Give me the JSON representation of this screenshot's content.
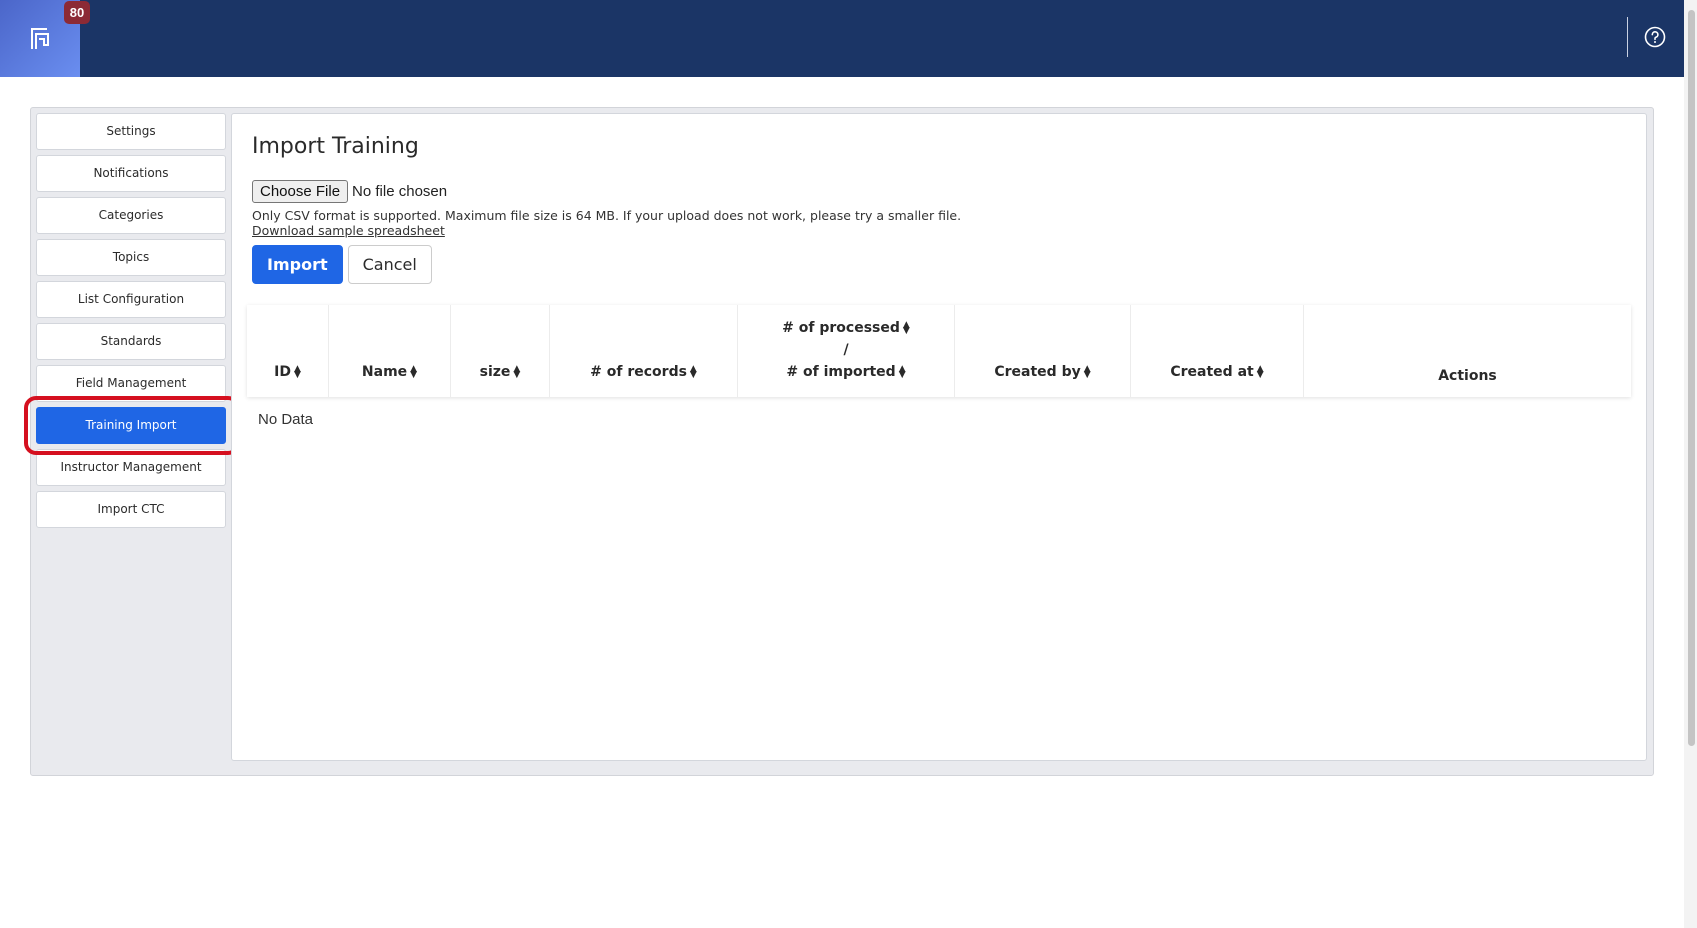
{
  "header": {
    "notification_count": "80",
    "logo_icon": "app-logo-icon",
    "help_icon": "question-circle-icon",
    "colors": {
      "topbar": "#1b3566",
      "accent": "#1f66e5",
      "badge": "#8c2a35",
      "highlight": "#d5101f"
    }
  },
  "sidebar": {
    "items": [
      {
        "label": "Settings"
      },
      {
        "label": "Notifications"
      },
      {
        "label": "Categories"
      },
      {
        "label": "Topics"
      },
      {
        "label": "List Configuration"
      },
      {
        "label": "Standards"
      },
      {
        "label": "Field Management"
      },
      {
        "label": "Training Import",
        "active": true
      },
      {
        "label": "Instructor Management"
      },
      {
        "label": "Import CTC"
      }
    ]
  },
  "main": {
    "title": "Import Training",
    "file_button": "Choose File",
    "file_status": "No file chosen",
    "help_text": "Only CSV format is supported. Maximum file size is 64 MB. If your upload does not work, please try a smaller file.",
    "sample_link": "Download sample spreadsheet",
    "import_button": "Import",
    "cancel_button": "Cancel",
    "table": {
      "columns": [
        "ID",
        "Name",
        "size",
        "# of records",
        "# of processed",
        "/",
        "# of imported",
        "Created by",
        "Created at",
        "Actions"
      ],
      "empty_text": "No Data"
    }
  }
}
